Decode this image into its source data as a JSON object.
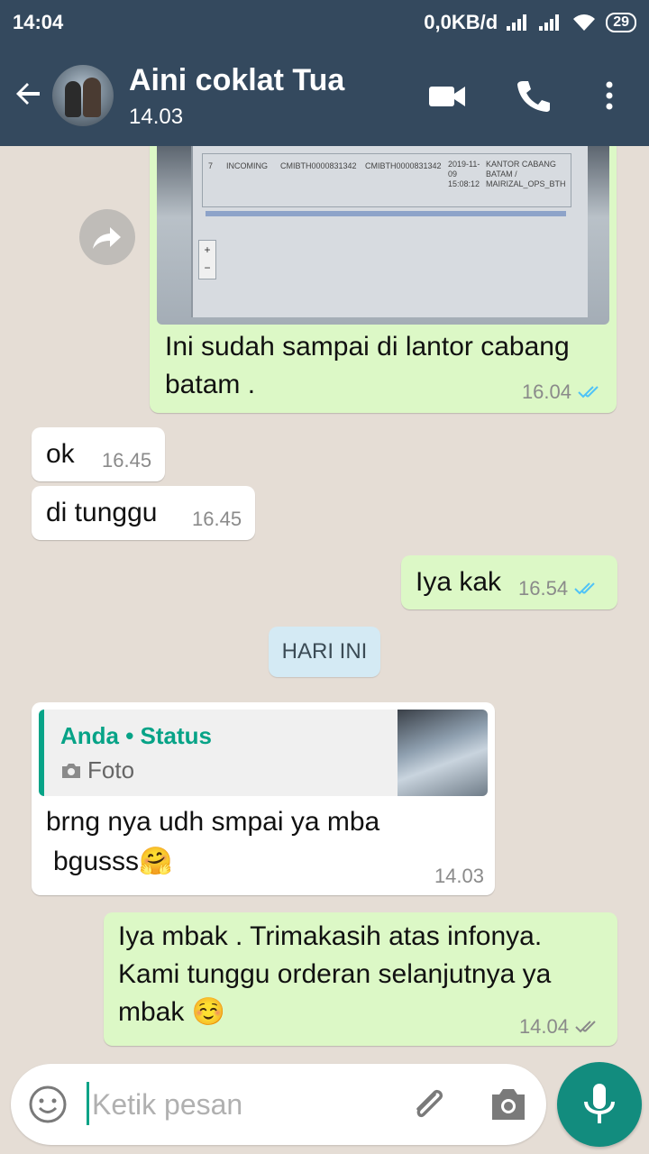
{
  "status_bar": {
    "time": "14:04",
    "network_speed": "0,0KB/d",
    "battery": "29"
  },
  "header": {
    "contact_name": "Aini coklat Tua",
    "last_seen": "14.03",
    "icons": [
      "back-arrow-icon",
      "video-call-icon",
      "phone-icon",
      "more-vert-icon"
    ]
  },
  "image_message": {
    "screen_row_number": "7",
    "screen_row_type": "INCOMING",
    "screen_row_code_1": "CMIBTH0000831342",
    "screen_row_code_2": "CMIBTH0000831342",
    "screen_row_date": "2019-11-09 15:08:12",
    "screen_row_office": "KANTOR CABANG BATAM / MAIRIZAL_OPS_BTH",
    "caption": "Ini sudah sampai di lantor cabang batam .",
    "time": "16.04"
  },
  "messages": [
    {
      "direction": "in",
      "text": "ok",
      "time": "16.45"
    },
    {
      "direction": "in",
      "text": "di tunggu",
      "time": "16.45"
    },
    {
      "direction": "out",
      "text": "Iya kak",
      "time": "16.54"
    }
  ],
  "date_divider": "HARI INI",
  "reply_message": {
    "quote_author": "Anda • Status",
    "quote_type": "Foto",
    "line1": "brng nya udh smpai ya mba",
    "line2": "bgusss🤗",
    "time": "14.03"
  },
  "last_message": {
    "line1": "Iya mbak . Trimakasih atas infonya.",
    "line2": "Kami tunggu orderan selanjutnya ya",
    "line3": "mbak ☺️",
    "time": "14.04"
  },
  "composer": {
    "placeholder": "Ketik pesan"
  },
  "colors": {
    "header": "#34495e",
    "outgoing": "#dcf8c6",
    "incoming": "#ffffff",
    "accent": "#128c7e",
    "read_ticks": "#4fc3f7"
  }
}
